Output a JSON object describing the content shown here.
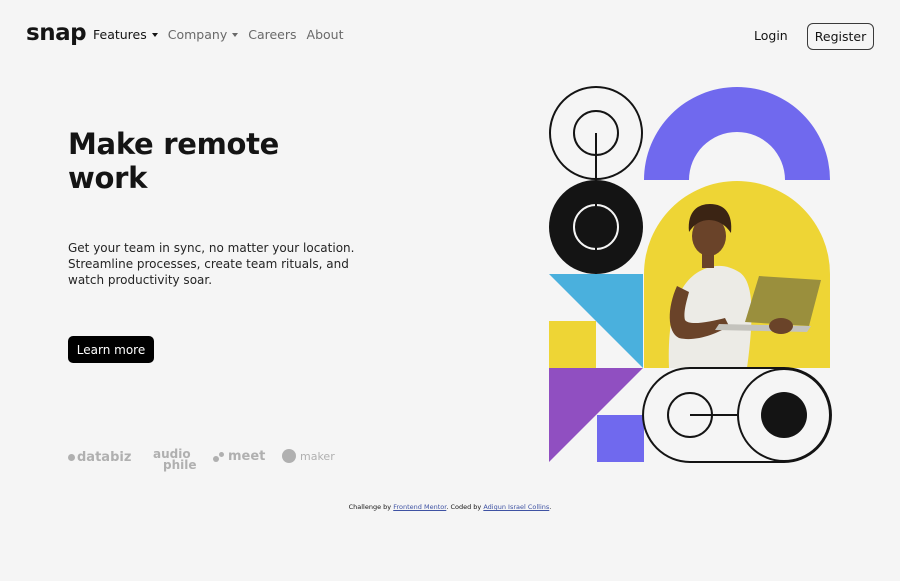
{
  "header": {
    "logo": "snap",
    "nav": [
      {
        "label": "Features",
        "dropdown": true,
        "active": true
      },
      {
        "label": "Company",
        "dropdown": true,
        "active": false
      },
      {
        "label": "Careers",
        "dropdown": false,
        "active": false
      },
      {
        "label": "About",
        "dropdown": false,
        "active": false
      }
    ],
    "login_label": "Login",
    "register_label": "Register"
  },
  "hero": {
    "title": "Make remote work",
    "description": "Get your team in sync, no matter your location. Streamline processes, create team rituals, and watch productivity soar.",
    "cta_label": "Learn more",
    "image_subject": "person-with-laptop"
  },
  "clients": {
    "databiz": "databiz",
    "audiophile_line1": "audio",
    "audiophile_line2": "phile",
    "meet": "meet",
    "maker": "maker"
  },
  "attribution": {
    "prefix": "Challenge by ",
    "link1": "Frontend Mentor",
    "middle": ". Coded by ",
    "link2": "Adigun Israel Collins",
    "suffix": "."
  },
  "colors": {
    "background": "#f5f5f5",
    "text": "#141414",
    "muted": "#696969",
    "purple": "#7069ee",
    "yellow": "#eed535",
    "blue": "#4ab0dd",
    "violet": "#904fc1"
  }
}
